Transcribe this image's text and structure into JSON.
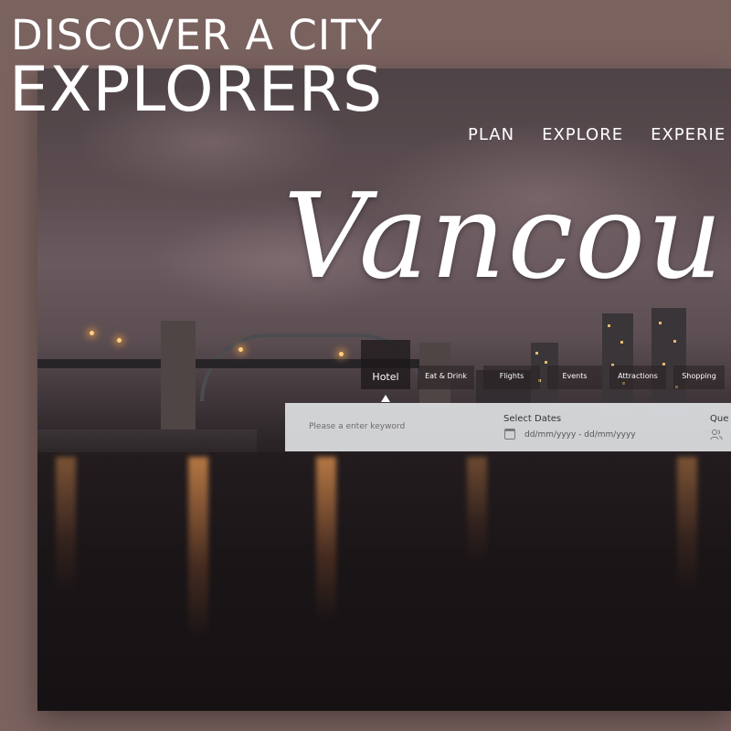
{
  "brand": {
    "tagline": "DISCOVER A CITY",
    "name": "EXPLORERS"
  },
  "nav": {
    "items": [
      "PLAN",
      "EXPLORE",
      "EXPERIE"
    ]
  },
  "hero": {
    "title": "Vancou"
  },
  "tabs": [
    {
      "label": "Hotel",
      "active": true
    },
    {
      "label": "Eat & Drink",
      "active": false
    },
    {
      "label": "Flights",
      "active": false
    },
    {
      "label": "Events",
      "active": false
    },
    {
      "label": "Attractions",
      "active": false
    },
    {
      "label": "Shopping",
      "active": false
    }
  ],
  "search": {
    "keyword_placeholder": "Please a enter keyword",
    "dates_label": "Select Dates",
    "dates_placeholder": "dd/mm/yyyy - dd/mm/yyyy",
    "guests_label": "Que"
  },
  "colors": {
    "page_bg": "#7a625f",
    "search_bg": "#ebeef0"
  },
  "icons": [
    "calendar-icon",
    "guests-icon"
  ]
}
